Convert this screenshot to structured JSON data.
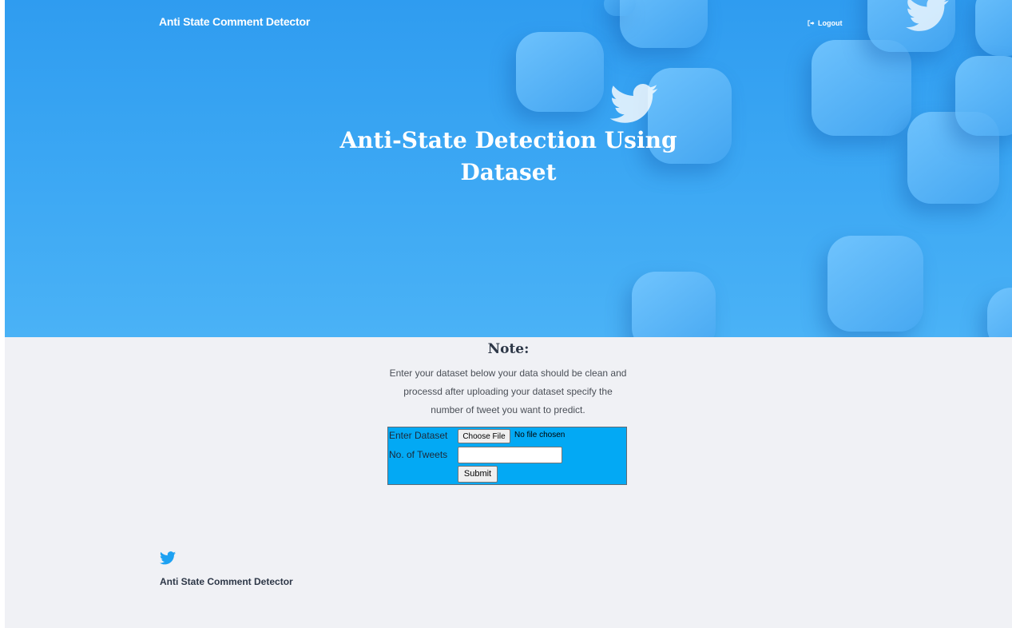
{
  "header": {
    "brand": "Anti State Comment Detector",
    "logout_label": "Logout"
  },
  "hero": {
    "title_line1": "Anti-State Detection Using",
    "title_line2": "Dataset"
  },
  "note": {
    "title": "Note:",
    "text_line1": "Enter your dataset below your data should be clean and",
    "text_line2": "processd after uploading your dataset specify the",
    "text_line3": "number of tweet you want to predict."
  },
  "form": {
    "dataset_label": "Enter Dataset",
    "choose_file_label": "Choose File",
    "file_status": "No file chosen",
    "tweets_label": "No. of Tweets",
    "tweets_value": "",
    "submit_label": "Submit"
  },
  "footer": {
    "brand": "Anti State Comment Detector"
  },
  "icons": {
    "logout": "logout-icon",
    "footer": "twitter-bird-icon"
  },
  "colors": {
    "hero_blue": "#3aa6f3",
    "form_bg": "#03a9f4",
    "page_bg": "#f0f1f5",
    "twitter_blue": "#1da1f2"
  }
}
